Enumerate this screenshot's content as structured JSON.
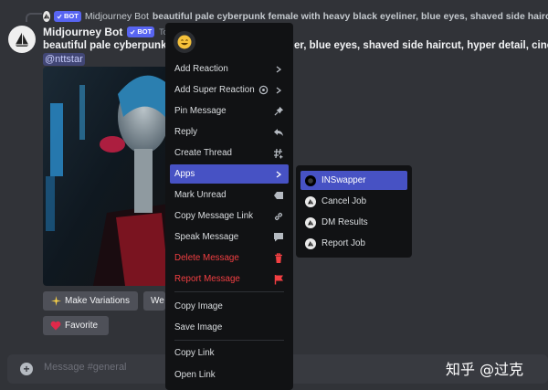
{
  "reply": {
    "author": "Midjourney Bot",
    "badge": "BOT",
    "text": "beautiful pale cyberpunk female with heavy black eyeliner, blue eyes, shaved side haircut, hyper detail, cinematic lighting, magic neon"
  },
  "message": {
    "author": "Midjourney Bot",
    "badge": "BOT",
    "timestamp": "Today a",
    "text": "beautiful pale cyberpunk fe",
    "text_tail": "er, blue eyes, shaved side haircut, hyper detail, cinematic lighting",
    "mention": "@nttstar",
    "buttons": {
      "make_variations": "Make Variations",
      "web": "We",
      "favorite": "Favorite"
    }
  },
  "context_menu": {
    "items": [
      {
        "label": "Add Reaction",
        "icon": "chevron-right-icon"
      },
      {
        "label": "Add Super Reaction",
        "icon": "super-reaction-icon"
      },
      {
        "label": "Pin Message",
        "icon": "pin-icon"
      },
      {
        "label": "Reply",
        "icon": "reply-icon"
      },
      {
        "label": "Create Thread",
        "icon": "thread-icon"
      },
      {
        "label": "Apps",
        "icon": "chevron-right-icon"
      },
      {
        "label": "Mark Unread",
        "icon": "mark-unread-icon"
      },
      {
        "label": "Copy Message Link",
        "icon": "link-icon"
      },
      {
        "label": "Speak Message",
        "icon": "speak-icon"
      },
      {
        "label": "Delete Message",
        "icon": "trash-icon"
      },
      {
        "label": "Report Message",
        "icon": "flag-icon"
      },
      {
        "label": "Copy Image"
      },
      {
        "label": "Save Image"
      },
      {
        "label": "Copy Link"
      },
      {
        "label": "Open Link"
      }
    ]
  },
  "apps_submenu": {
    "items": [
      {
        "label": "INSwapper"
      },
      {
        "label": "Cancel Job"
      },
      {
        "label": "DM Results"
      },
      {
        "label": "Report Job"
      }
    ]
  },
  "input": {
    "placeholder": "Message #general"
  },
  "watermark": "知乎 @过克",
  "colors": {
    "background": "#313338",
    "menu": "#111214",
    "accent": "#4752c4",
    "danger": "#f23f42",
    "bot_badge": "#5865f2"
  }
}
